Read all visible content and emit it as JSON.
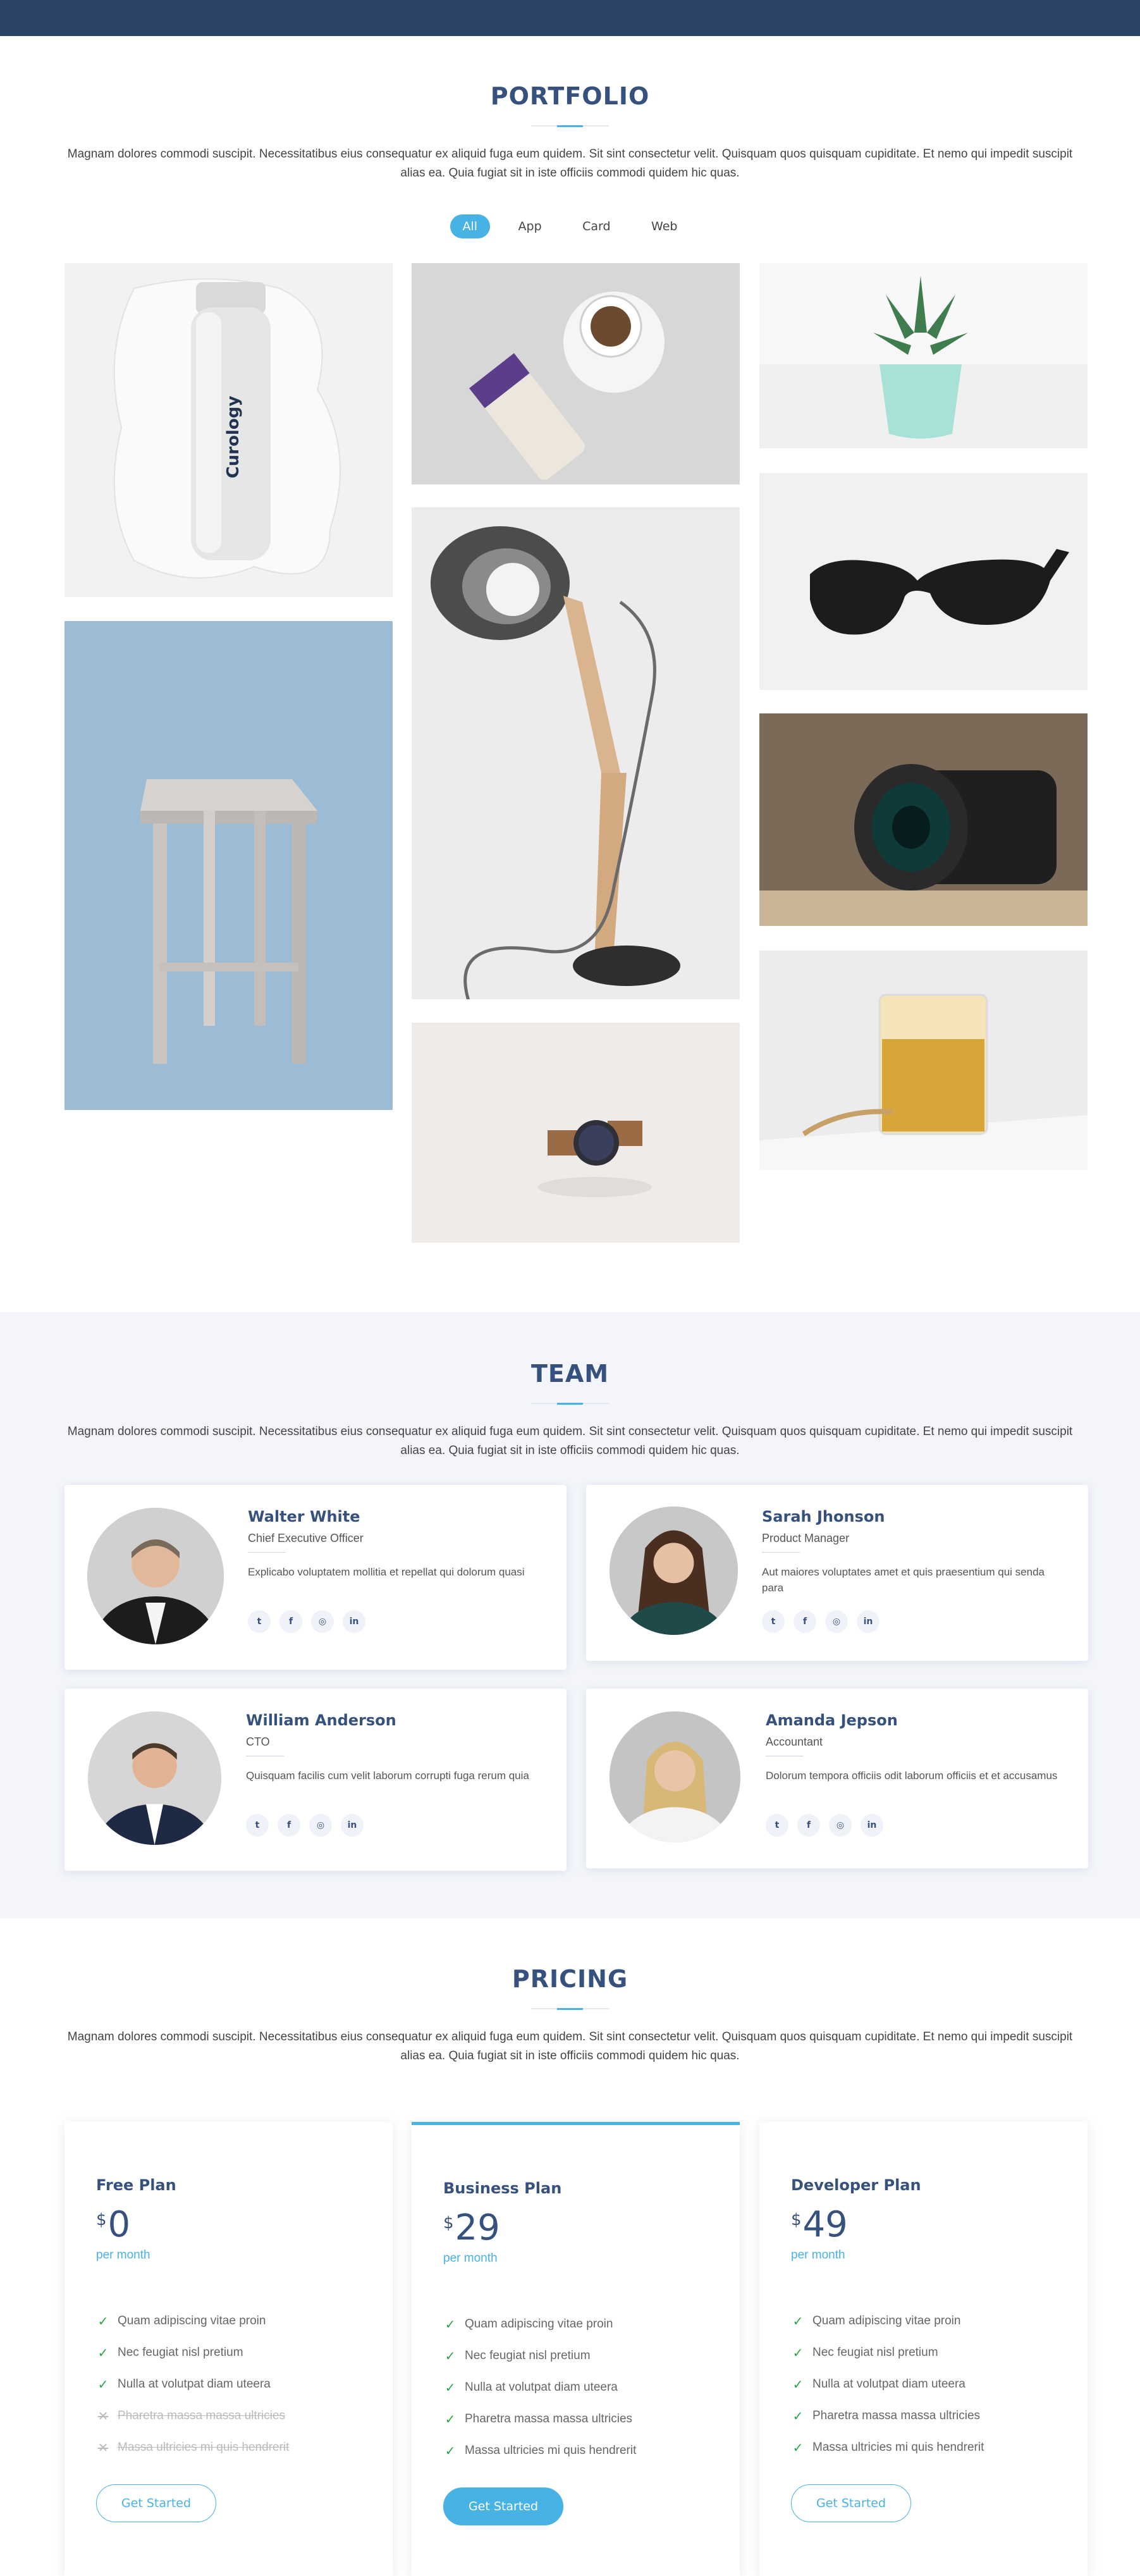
{
  "portfolio": {
    "title": "PORTFOLIO",
    "desc": "Magnam dolores commodi suscipit. Necessitatibus eius consequatur ex aliquid fuga eum quidem. Sit sint consectetur velit. Quisquam quos quisquam cupiditate. Et nemo qui impedit suscipit alias ea. Quia fugiat sit in iste officiis commodi quidem hic quas.",
    "filters": [
      "All",
      "App",
      "Card",
      "Web"
    ],
    "tube_brand": "Curology"
  },
  "team": {
    "title": "TEAM",
    "desc": "Magnam dolores commodi suscipit. Necessitatibus eius consequatur ex aliquid fuga eum quidem. Sit sint consectetur velit. Quisquam quos quisquam cupiditate. Et nemo qui impedit suscipit alias ea. Quia fugiat sit in iste officiis commodi quidem hic quas.",
    "members": [
      {
        "name": "Walter White",
        "role": "Chief Executive Officer",
        "desc": "Explicabo voluptatem mollitia et repellat qui dolorum quasi"
      },
      {
        "name": "Sarah Jhonson",
        "role": "Product Manager",
        "desc": "Aut maiores voluptates amet et quis praesentium qui senda para"
      },
      {
        "name": "William Anderson",
        "role": "CTO",
        "desc": "Quisquam facilis cum velit laborum corrupti fuga rerum quia"
      },
      {
        "name": "Amanda Jepson",
        "role": "Accountant",
        "desc": "Dolorum tempora officiis odit laborum officiis et et accusamus"
      }
    ],
    "social_icons": [
      "twitter-icon",
      "facebook-icon",
      "instagram-icon",
      "linkedin-icon"
    ]
  },
  "pricing": {
    "title": "PRICING",
    "desc": "Magnam dolores commodi suscipit. Necessitatibus eius consequatur ex aliquid fuga eum quidem. Sit sint consectetur velit. Quisquam quos quisquam cupiditate. Et nemo qui impedit suscipit alias ea. Quia fugiat sit in iste officiis commodi quidem hic quas.",
    "currency": "$",
    "plans": [
      {
        "name": "Free Plan",
        "price": "0",
        "period": "per month",
        "button": "Get Started",
        "features": [
          "Quam adipiscing vitae proin",
          "Nec feugiat nisl pretium",
          "Nulla at volutpat diam uteera",
          "Pharetra massa massa ultricies",
          "Massa ultricies mi quis hendrerit"
        ]
      },
      {
        "name": "Business Plan",
        "price": "29",
        "period": "per month",
        "button": "Get Started",
        "features": [
          "Quam adipiscing vitae proin",
          "Nec feugiat nisl pretium",
          "Nulla at volutpat diam uteera",
          "Pharetra massa massa ultricies",
          "Massa ultricies mi quis hendrerit"
        ]
      },
      {
        "name": "Developer Plan",
        "price": "49",
        "period": "per month",
        "button": "Get Started",
        "features": [
          "Quam adipiscing vitae proin",
          "Nec feugiat nisl pretium",
          "Nulla at volutpat diam uteera",
          "Pharetra massa massa ultricies",
          "Massa ultricies mi quis hendrerit"
        ]
      }
    ]
  },
  "colors": {
    "accent": "#47b2e4",
    "heading": "#37517e",
    "header_bar": "#2c4466"
  }
}
